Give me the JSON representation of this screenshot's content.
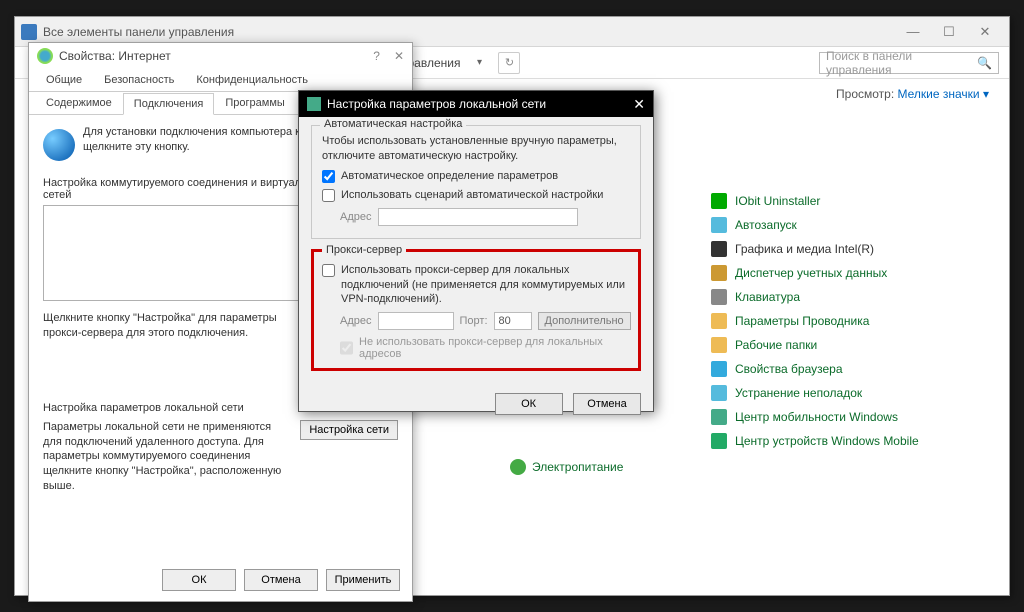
{
  "cp": {
    "title": "Все элементы панели управления",
    "breadcrumb": "управления",
    "search_placeholder": "Поиск в панели управления",
    "view_label": "Просмотр:",
    "view_value": "Мелкие значки",
    "items": [
      "IObit Uninstaller",
      "Автозапуск",
      "Графика и медиа Intel(R)",
      "Диспетчер учетных данных",
      "Клавиатура",
      "Параметры Проводника",
      "Рабочие папки",
      "Свойства браузера",
      "Устранение неполадок",
      "Центр мобильности Windows",
      "Центр устройств Windows Mobile"
    ],
    "electro": "Электропитание"
  },
  "ip": {
    "title": "Свойства: Интернет",
    "tabs_row1": [
      "Общие",
      "Безопасность",
      "Конфиденциальность"
    ],
    "tabs_row2": [
      "Содержимое",
      "Подключения",
      "Программы"
    ],
    "active_tab": "Подключения",
    "setup_text": "Для установки подключения компьютера к Интернету щелкните эту кнопку.",
    "dial_label": "Настройка коммутируемого соединения и виртуальных частных сетей",
    "dial_hint": "Щелкните кнопку \"Настройка\" для параметры прокси-сервера для этого подключения.",
    "lan_label": "Настройка параметров локальной сети",
    "lan_hint": "Параметры локальной сети не применяются для подключений удаленного доступа. Для параметры коммутируемого соединения щелкните кнопку \"Настройка\", расположенную выше.",
    "lan_button": "Настройка сети",
    "ok": "ОК",
    "cancel": "Отмена",
    "apply": "Применить"
  },
  "lan": {
    "title": "Настройка параметров локальной сети",
    "auto_legend": "Автоматическая настройка",
    "auto_note": "Чтобы использовать установленные вручную параметры, отключите автоматическую настройку.",
    "auto_detect": "Автоматическое определение параметров",
    "auto_script": "Использовать сценарий автоматической настройки",
    "address_label": "Адрес",
    "proxy_legend": "Прокси-сервер",
    "proxy_use": "Использовать прокси-сервер для локальных подключений (не применяется для коммутируемых или VPN-подключений).",
    "port_label": "Порт:",
    "port_value": "80",
    "advanced": "Дополнительно",
    "bypass": "Не использовать прокси-сервер для локальных адресов",
    "ok": "ОК",
    "cancel": "Отмена"
  }
}
